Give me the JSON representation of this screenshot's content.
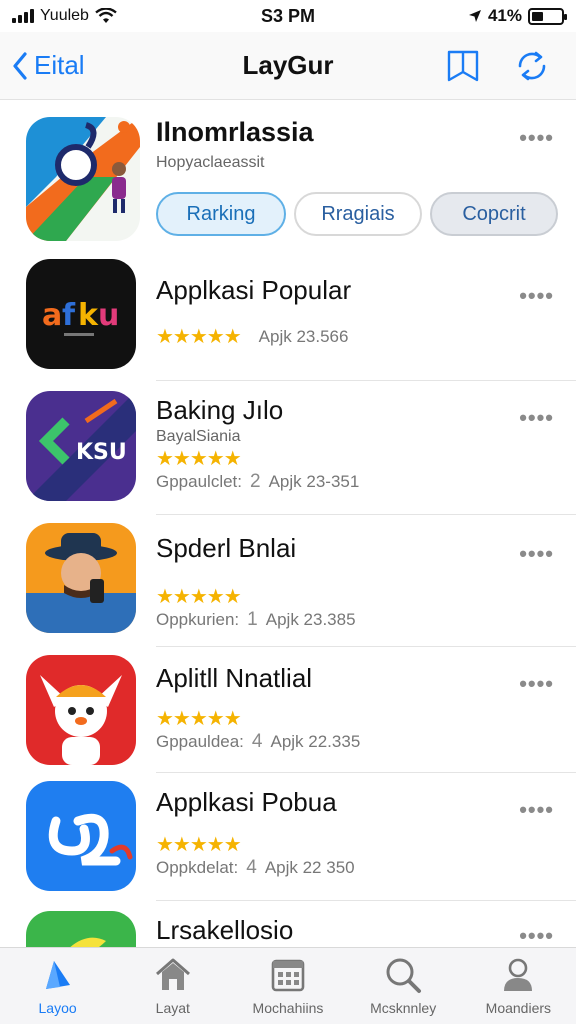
{
  "status": {
    "carrier": "Yuuleb",
    "time": "S3 PM",
    "battery": "41%",
    "battery_level": 0.41
  },
  "nav": {
    "back_label": "Eital",
    "title": "LayGur"
  },
  "featured": {
    "name": "Ilnomrlassia",
    "subtitle": "Hopyaclaeassit",
    "chips": [
      "Rarking",
      "Rragiais",
      "Copcrit"
    ]
  },
  "apps": [
    {
      "name": "Applkasi Popular",
      "subtitle": "",
      "stars": "★★★★★",
      "meta_left": "",
      "rank_num": "",
      "meta_right": "Apjk 23.566"
    },
    {
      "name": "Baking Jılo",
      "subtitle": "BayalSiania",
      "stars": "★★★★★",
      "meta_left": "Gppaulclet:",
      "rank_num": "2",
      "meta_right": "Apjk 23-351"
    },
    {
      "name": "Spderl Bnlai",
      "subtitle": "",
      "stars": "★★★★★",
      "meta_left": "Oppkurien:",
      "rank_num": "1",
      "meta_right": "Apjk 23.385"
    },
    {
      "name": "Aplitll Nnatlial",
      "subtitle": "",
      "stars": "★★★★★",
      "meta_left": "Gppauldea:",
      "rank_num": "4",
      "meta_right": "Apjk 22.335"
    },
    {
      "name": "Applkasi Pobua",
      "subtitle": "",
      "stars": "★★★★★",
      "meta_left": "Oppkdelat:",
      "rank_num": "4",
      "meta_right": "Apjk 22 350"
    },
    {
      "name": "Lrsakellosio",
      "subtitle": "",
      "stars": "",
      "meta_left": "",
      "rank_num": "",
      "meta_right": ""
    }
  ],
  "more_label": "••••",
  "tabs": [
    {
      "label": "Layoo",
      "icon": "app-store-icon"
    },
    {
      "label": "Layat",
      "icon": "house-icon"
    },
    {
      "label": "Mochahiins",
      "icon": "calendar-grid-icon"
    },
    {
      "label": "Mcsknnley",
      "icon": "search-icon"
    },
    {
      "label": "Moandiers",
      "icon": "person-icon"
    }
  ],
  "colors": {
    "accent": "#1a7cf5",
    "star": "#f5b301"
  }
}
